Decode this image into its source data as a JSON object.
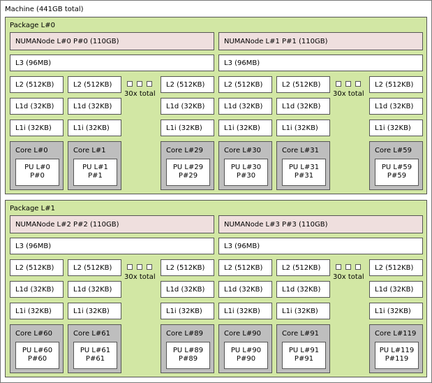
{
  "machine": {
    "label": "Machine (441GB total)"
  },
  "packages": [
    {
      "label": "Package L#0",
      "numa": [
        {
          "label": "NUMANode L#0 P#0 (110GB)"
        },
        {
          "label": "NUMANode L#1 P#1 (110GB)"
        }
      ],
      "l3": [
        {
          "label": "L3 (96MB)"
        },
        {
          "label": "L3 (96MB)"
        }
      ],
      "groups": [
        {
          "collapsed_label": "30x total",
          "cores": [
            {
              "l2": "L2 (512KB)",
              "l1d": "L1d (32KB)",
              "l1i": "L1i (32KB)",
              "core": "Core L#0",
              "pu_l": "PU L#0",
              "pu_p": "P#0"
            },
            {
              "l2": "L2 (512KB)",
              "l1d": "L1d (32KB)",
              "l1i": "L1i (32KB)",
              "core": "Core L#1",
              "pu_l": "PU L#1",
              "pu_p": "P#1"
            },
            {
              "l2": "L2 (512KB)",
              "l1d": "L1d (32KB)",
              "l1i": "L1i (32KB)",
              "core": "Core L#29",
              "pu_l": "PU L#29",
              "pu_p": "P#29"
            }
          ]
        },
        {
          "collapsed_label": "30x total",
          "cores": [
            {
              "l2": "L2 (512KB)",
              "l1d": "L1d (32KB)",
              "l1i": "L1i (32KB)",
              "core": "Core L#30",
              "pu_l": "PU L#30",
              "pu_p": "P#30"
            },
            {
              "l2": "L2 (512KB)",
              "l1d": "L1d (32KB)",
              "l1i": "L1i (32KB)",
              "core": "Core L#31",
              "pu_l": "PU L#31",
              "pu_p": "P#31"
            },
            {
              "l2": "L2 (512KB)",
              "l1d": "L1d (32KB)",
              "l1i": "L1i (32KB)",
              "core": "Core L#59",
              "pu_l": "PU L#59",
              "pu_p": "P#59"
            }
          ]
        }
      ]
    },
    {
      "label": "Package L#1",
      "numa": [
        {
          "label": "NUMANode L#2 P#2 (110GB)"
        },
        {
          "label": "NUMANode L#3 P#3 (110GB)"
        }
      ],
      "l3": [
        {
          "label": "L3 (96MB)"
        },
        {
          "label": "L3 (96MB)"
        }
      ],
      "groups": [
        {
          "collapsed_label": "30x total",
          "cores": [
            {
              "l2": "L2 (512KB)",
              "l1d": "L1d (32KB)",
              "l1i": "L1i (32KB)",
              "core": "Core L#60",
              "pu_l": "PU L#60",
              "pu_p": "P#60"
            },
            {
              "l2": "L2 (512KB)",
              "l1d": "L1d (32KB)",
              "l1i": "L1i (32KB)",
              "core": "Core L#61",
              "pu_l": "PU L#61",
              "pu_p": "P#61"
            },
            {
              "l2": "L2 (512KB)",
              "l1d": "L1d (32KB)",
              "l1i": "L1i (32KB)",
              "core": "Core L#89",
              "pu_l": "PU L#89",
              "pu_p": "P#89"
            }
          ]
        },
        {
          "collapsed_label": "30x total",
          "cores": [
            {
              "l2": "L2 (512KB)",
              "l1d": "L1d (32KB)",
              "l1i": "L1i (32KB)",
              "core": "Core L#90",
              "pu_l": "PU L#90",
              "pu_p": "P#90"
            },
            {
              "l2": "L2 (512KB)",
              "l1d": "L1d (32KB)",
              "l1i": "L1i (32KB)",
              "core": "Core L#91",
              "pu_l": "PU L#91",
              "pu_p": "P#91"
            },
            {
              "l2": "L2 (512KB)",
              "l1d": "L1d (32KB)",
              "l1i": "L1i (32KB)",
              "core": "Core L#119",
              "pu_l": "PU L#119",
              "pu_p": "P#119"
            }
          ]
        }
      ]
    }
  ],
  "colors": {
    "package_bg": "#d2e7a4",
    "numa_bg": "#efdfde",
    "cache_bg": "#ffffff",
    "core_bg": "#bebebe",
    "pu_bg": "#ffffff",
    "border": "#555555"
  }
}
